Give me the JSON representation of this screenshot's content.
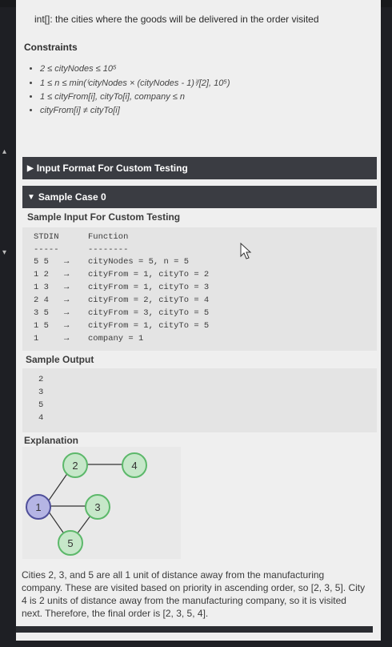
{
  "header_text": "int[]: the cities where the goods will be delivered in the order visited",
  "constraints": {
    "title": "Constraints",
    "items": [
      "2 ≤ cityNodes ≤ 10⁵",
      "1 ≤ n ≤ min(⁽cityNodes × (cityNodes - 1)⁾/[2], 10⁵)",
      "1 ≤ cityFrom[i], cityTo[i], company ≤ n",
      "cityFrom[i] ≠ cityTo[i]"
    ]
  },
  "input_format_bar": {
    "label": "Input Format For Custom Testing",
    "arrow": "▶"
  },
  "sample_case_bar": {
    "label": "Sample Case 0",
    "arrow": "▼"
  },
  "sample_input": {
    "title": "Sample Input For Custom Testing",
    "col_stdin": "STDIN",
    "col_function": "Function",
    "sep_stdin": "-----",
    "sep_function": "--------",
    "rows": [
      {
        "stdin": "5 5",
        "arrow": "→",
        "func": "cityNodes = 5, n = 5"
      },
      {
        "stdin": "1 2",
        "arrow": "→",
        "func": "cityFrom = 1, cityTo = 2"
      },
      {
        "stdin": "1 3",
        "arrow": "→",
        "func": "cityFrom = 1, cityTo = 3"
      },
      {
        "stdin": "2 4",
        "arrow": "→",
        "func": "cityFrom = 2, cityTo = 4"
      },
      {
        "stdin": "3 5",
        "arrow": "→",
        "func": "cityFrom = 3, cityTo = 5"
      },
      {
        "stdin": "1 5",
        "arrow": "→",
        "func": "cityFrom = 1, cityTo = 5"
      },
      {
        "stdin": "1",
        "arrow": "→",
        "func": "company = 1"
      }
    ]
  },
  "sample_output": {
    "title": "Sample Output",
    "values": [
      "2",
      "3",
      "5",
      "4"
    ]
  },
  "explanation": {
    "title": "Explanation",
    "nodes": [
      "1",
      "2",
      "3",
      "4",
      "5"
    ],
    "text": "Cities 2, 3, and 5 are all 1 unit of distance away from the manufacturing company. These are visited based on priority in ascending order, so [2, 3, 5]. City 4 is 2 units of distance away from the manufacturing company, so it is visited next. Therefore, the final order is [2, 3, 5, 4]."
  },
  "colors": {
    "bar": "#3a3c42",
    "green_node_fill": "#c6e7c9",
    "green_node_border": "#5cb86a",
    "blue_node_fill": "#b5b5e4",
    "blue_node_border": "#4f4f9a"
  }
}
